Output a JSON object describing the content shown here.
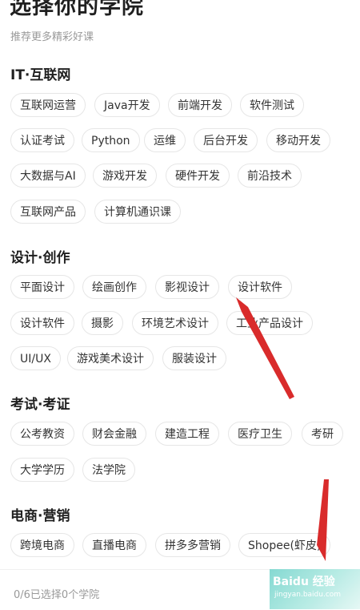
{
  "header": {
    "title": "选择你的学院",
    "subtitle": "推荐更多精彩好课"
  },
  "sections": [
    {
      "title": "IT·互联网",
      "tags": [
        "互联网运营",
        "Java开发",
        "前端开发",
        "软件测试",
        "认证考试",
        "Python",
        "运维",
        "后台开发",
        "移动开发",
        "大数据与AI",
        "游戏开发",
        "硬件开发",
        "前沿技术",
        "互联网产品",
        "计算机通识课"
      ]
    },
    {
      "title": "设计·创作",
      "tags": [
        "平面设计",
        "绘画创作",
        "影视设计",
        "设计软件",
        "设计软件",
        "摄影",
        "环境艺术设计",
        "工业产品设计",
        "UI/UX",
        "游戏美术设计",
        "服装设计"
      ]
    },
    {
      "title": "考试·考证",
      "tags": [
        "公考教资",
        "财会金融",
        "建造工程",
        "医疗卫生",
        "考研",
        "大学学历",
        "法学院"
      ]
    },
    {
      "title": "电商·营销",
      "tags": [
        "跨境电商",
        "直播电商",
        "拼多多营销",
        "Shopee(虾皮)"
      ]
    }
  ],
  "footer": {
    "selection_count": "0/6已选择0个学院"
  },
  "watermark": {
    "brand": "Baidu 经验",
    "url": "jingyan.baidu.com"
  },
  "colors": {
    "annotation_arrow": "#d92b2b",
    "tag_border": "#e6e6e6"
  }
}
